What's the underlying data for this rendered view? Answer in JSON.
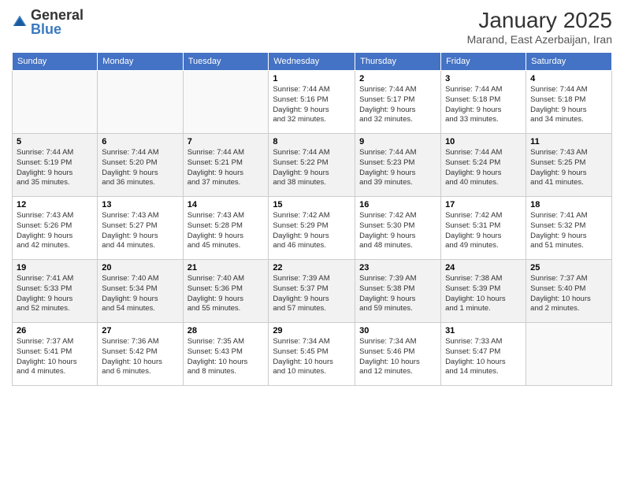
{
  "header": {
    "logo": {
      "general": "General",
      "blue": "Blue"
    },
    "title": "January 2025",
    "subtitle": "Marand, East Azerbaijan, Iran"
  },
  "days_of_week": [
    "Sunday",
    "Monday",
    "Tuesday",
    "Wednesday",
    "Thursday",
    "Friday",
    "Saturday"
  ],
  "weeks": [
    [
      {
        "day": "",
        "info": ""
      },
      {
        "day": "",
        "info": ""
      },
      {
        "day": "",
        "info": ""
      },
      {
        "day": "1",
        "info": "Sunrise: 7:44 AM\nSunset: 5:16 PM\nDaylight: 9 hours\nand 32 minutes."
      },
      {
        "day": "2",
        "info": "Sunrise: 7:44 AM\nSunset: 5:17 PM\nDaylight: 9 hours\nand 32 minutes."
      },
      {
        "day": "3",
        "info": "Sunrise: 7:44 AM\nSunset: 5:18 PM\nDaylight: 9 hours\nand 33 minutes."
      },
      {
        "day": "4",
        "info": "Sunrise: 7:44 AM\nSunset: 5:18 PM\nDaylight: 9 hours\nand 34 minutes."
      }
    ],
    [
      {
        "day": "5",
        "info": "Sunrise: 7:44 AM\nSunset: 5:19 PM\nDaylight: 9 hours\nand 35 minutes."
      },
      {
        "day": "6",
        "info": "Sunrise: 7:44 AM\nSunset: 5:20 PM\nDaylight: 9 hours\nand 36 minutes."
      },
      {
        "day": "7",
        "info": "Sunrise: 7:44 AM\nSunset: 5:21 PM\nDaylight: 9 hours\nand 37 minutes."
      },
      {
        "day": "8",
        "info": "Sunrise: 7:44 AM\nSunset: 5:22 PM\nDaylight: 9 hours\nand 38 minutes."
      },
      {
        "day": "9",
        "info": "Sunrise: 7:44 AM\nSunset: 5:23 PM\nDaylight: 9 hours\nand 39 minutes."
      },
      {
        "day": "10",
        "info": "Sunrise: 7:44 AM\nSunset: 5:24 PM\nDaylight: 9 hours\nand 40 minutes."
      },
      {
        "day": "11",
        "info": "Sunrise: 7:43 AM\nSunset: 5:25 PM\nDaylight: 9 hours\nand 41 minutes."
      }
    ],
    [
      {
        "day": "12",
        "info": "Sunrise: 7:43 AM\nSunset: 5:26 PM\nDaylight: 9 hours\nand 42 minutes."
      },
      {
        "day": "13",
        "info": "Sunrise: 7:43 AM\nSunset: 5:27 PM\nDaylight: 9 hours\nand 44 minutes."
      },
      {
        "day": "14",
        "info": "Sunrise: 7:43 AM\nSunset: 5:28 PM\nDaylight: 9 hours\nand 45 minutes."
      },
      {
        "day": "15",
        "info": "Sunrise: 7:42 AM\nSunset: 5:29 PM\nDaylight: 9 hours\nand 46 minutes."
      },
      {
        "day": "16",
        "info": "Sunrise: 7:42 AM\nSunset: 5:30 PM\nDaylight: 9 hours\nand 48 minutes."
      },
      {
        "day": "17",
        "info": "Sunrise: 7:42 AM\nSunset: 5:31 PM\nDaylight: 9 hours\nand 49 minutes."
      },
      {
        "day": "18",
        "info": "Sunrise: 7:41 AM\nSunset: 5:32 PM\nDaylight: 9 hours\nand 51 minutes."
      }
    ],
    [
      {
        "day": "19",
        "info": "Sunrise: 7:41 AM\nSunset: 5:33 PM\nDaylight: 9 hours\nand 52 minutes."
      },
      {
        "day": "20",
        "info": "Sunrise: 7:40 AM\nSunset: 5:34 PM\nDaylight: 9 hours\nand 54 minutes."
      },
      {
        "day": "21",
        "info": "Sunrise: 7:40 AM\nSunset: 5:36 PM\nDaylight: 9 hours\nand 55 minutes."
      },
      {
        "day": "22",
        "info": "Sunrise: 7:39 AM\nSunset: 5:37 PM\nDaylight: 9 hours\nand 57 minutes."
      },
      {
        "day": "23",
        "info": "Sunrise: 7:39 AM\nSunset: 5:38 PM\nDaylight: 9 hours\nand 59 minutes."
      },
      {
        "day": "24",
        "info": "Sunrise: 7:38 AM\nSunset: 5:39 PM\nDaylight: 10 hours\nand 1 minute."
      },
      {
        "day": "25",
        "info": "Sunrise: 7:37 AM\nSunset: 5:40 PM\nDaylight: 10 hours\nand 2 minutes."
      }
    ],
    [
      {
        "day": "26",
        "info": "Sunrise: 7:37 AM\nSunset: 5:41 PM\nDaylight: 10 hours\nand 4 minutes."
      },
      {
        "day": "27",
        "info": "Sunrise: 7:36 AM\nSunset: 5:42 PM\nDaylight: 10 hours\nand 6 minutes."
      },
      {
        "day": "28",
        "info": "Sunrise: 7:35 AM\nSunset: 5:43 PM\nDaylight: 10 hours\nand 8 minutes."
      },
      {
        "day": "29",
        "info": "Sunrise: 7:34 AM\nSunset: 5:45 PM\nDaylight: 10 hours\nand 10 minutes."
      },
      {
        "day": "30",
        "info": "Sunrise: 7:34 AM\nSunset: 5:46 PM\nDaylight: 10 hours\nand 12 minutes."
      },
      {
        "day": "31",
        "info": "Sunrise: 7:33 AM\nSunset: 5:47 PM\nDaylight: 10 hours\nand 14 minutes."
      },
      {
        "day": "",
        "info": ""
      }
    ]
  ]
}
